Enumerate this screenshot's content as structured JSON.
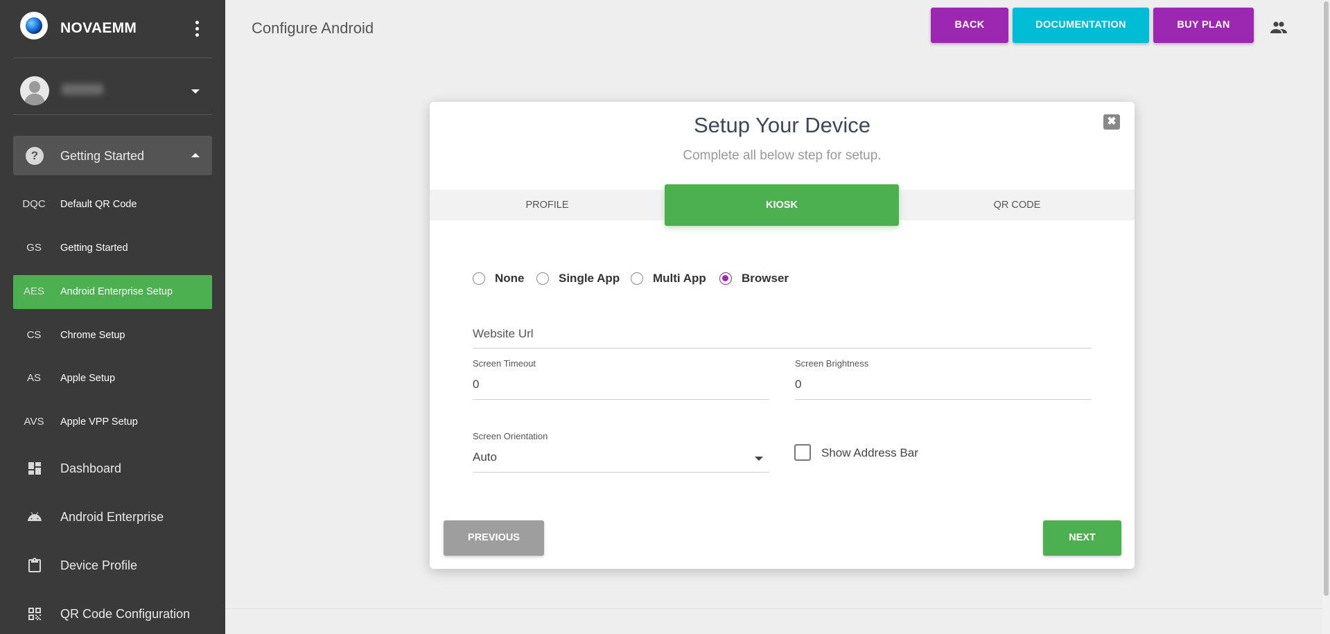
{
  "app": {
    "name": "NOVAEMM"
  },
  "sidebar": {
    "group": {
      "label": "Getting Started",
      "icon": "help-circle-icon"
    },
    "sub_items": [
      {
        "abbr": "DQC",
        "label": "Default QR Code"
      },
      {
        "abbr": "GS",
        "label": "Getting Started"
      },
      {
        "abbr": "AES",
        "label": "Android Enterprise Setup",
        "active": true
      },
      {
        "abbr": "CS",
        "label": "Chrome Setup"
      },
      {
        "abbr": "AS",
        "label": "Apple Setup"
      },
      {
        "abbr": "AVS",
        "label": "Apple VPP Setup"
      }
    ],
    "main_items": [
      {
        "label": "Dashboard",
        "icon": "dashboard-icon"
      },
      {
        "label": "Android Enterprise",
        "icon": "android-icon"
      },
      {
        "label": "Device Profile",
        "icon": "clipboard-icon"
      },
      {
        "label": "QR Code Configuration",
        "icon": "qr-code-icon"
      }
    ]
  },
  "header": {
    "title": "Configure Android",
    "buttons": {
      "back": "BACK",
      "documentation": "DOCUMENTATION",
      "buy_plan": "BUY PLAN"
    }
  },
  "modal": {
    "title": "Setup Your Device",
    "subtitle": "Complete all below step for setup.",
    "close_symbol": "✖",
    "tabs": [
      {
        "label": "PROFILE"
      },
      {
        "label": "KIOSK",
        "active": true
      },
      {
        "label": "QR CODE"
      }
    ],
    "kiosk_mode": {
      "options": [
        "None",
        "Single App",
        "Multi App",
        "Browser"
      ],
      "selected": "Browser"
    },
    "website_url": {
      "label": "Website Url",
      "value": ""
    },
    "screen_timeout": {
      "label": "Screen Timeout",
      "value": "0"
    },
    "screen_brightness": {
      "label": "Screen Brightness",
      "value": "0"
    },
    "screen_orientation": {
      "label": "Screen Orientation",
      "value": "Auto"
    },
    "show_address_bar": {
      "label": "Show Address Bar",
      "checked": false
    },
    "buttons": {
      "previous": "PREVIOUS",
      "next": "NEXT"
    }
  },
  "colors": {
    "sidebar_bg": "#3a3a3a",
    "active_green": "#4caf50",
    "purple": "#9c27b0",
    "cyan": "#00bcd4",
    "gray_button": "#9e9e9e"
  }
}
